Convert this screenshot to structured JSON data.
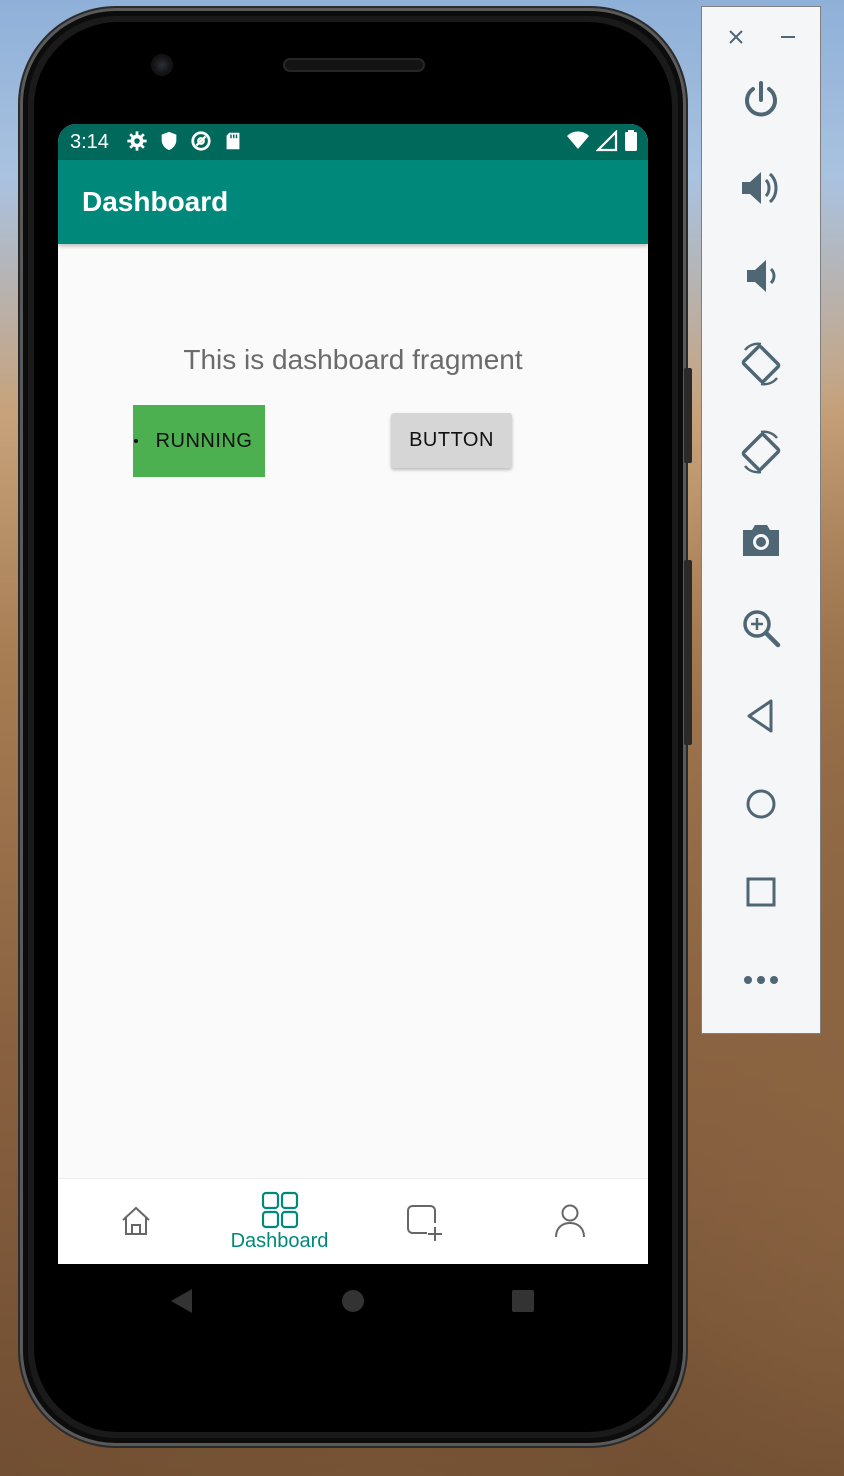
{
  "status_bar": {
    "time": "3:14",
    "left_icons": [
      "settings-icon",
      "shield-icon",
      "at-sign-icon",
      "sd-card-icon"
    ],
    "right_icons": [
      "wifi-icon",
      "cellular-signal-icon",
      "battery-icon"
    ]
  },
  "app_bar": {
    "title": "Dashboard"
  },
  "content": {
    "text": "This is dashboard fragment",
    "running_button": "RUNNING",
    "plain_button": "BUTTON"
  },
  "bottom_nav": {
    "items": [
      {
        "icon": "home-icon",
        "label": ""
      },
      {
        "icon": "dashboard-grid-icon",
        "label": "Dashboard",
        "selected": true
      },
      {
        "icon": "add-square-icon",
        "label": ""
      },
      {
        "icon": "person-icon",
        "label": ""
      }
    ]
  },
  "system_nav": [
    "back-triangle-icon",
    "home-circle-icon",
    "recents-square-icon"
  ],
  "emulator_panel": {
    "controls": [
      "close-icon",
      "minimize-icon"
    ],
    "buttons": [
      "power-icon",
      "volume-up-icon",
      "volume-down-icon",
      "rotate-left-icon",
      "rotate-right-icon",
      "camera-icon",
      "zoom-icon",
      "back-icon",
      "home-icon",
      "overview-icon",
      "more-icon"
    ]
  },
  "colors": {
    "status_bar": "#00695c",
    "app_bar": "#00897b",
    "accent": "#00897b",
    "running_button": "#4caf50",
    "plain_button": "#d6d6d6",
    "panel_icon": "#4f6675"
  }
}
